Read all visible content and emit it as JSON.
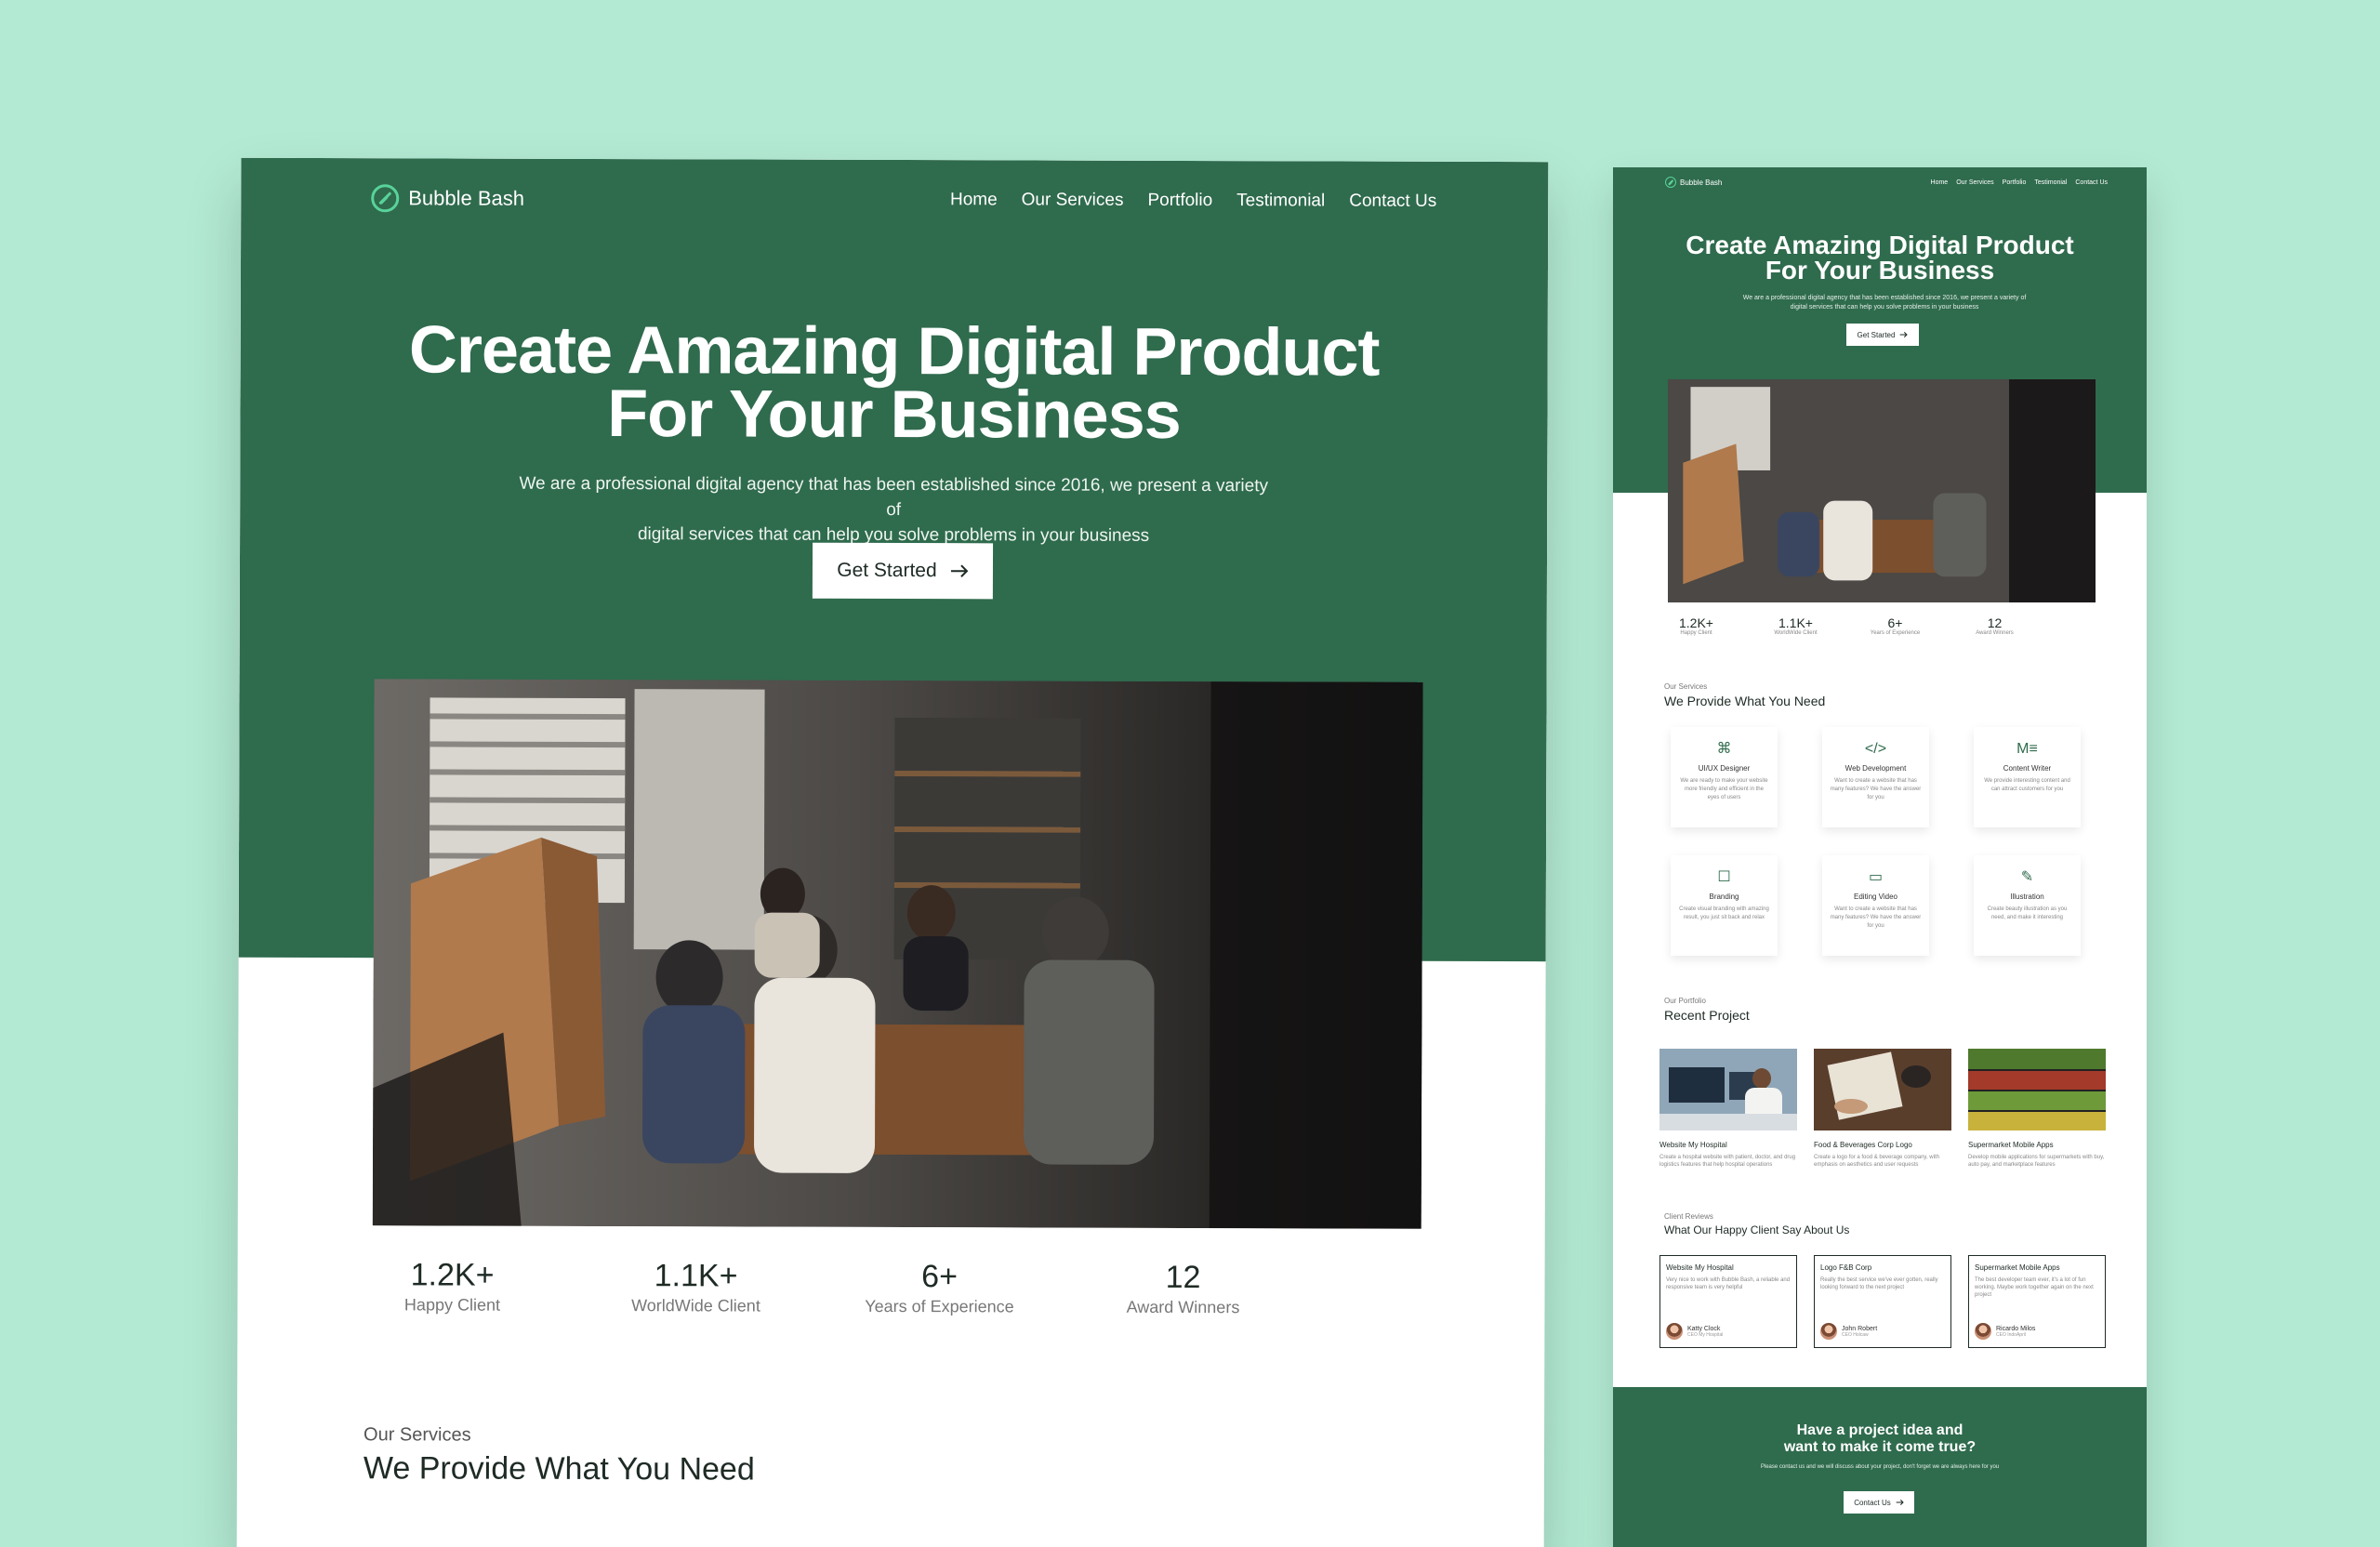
{
  "desktop": {
    "brand": "Bubble Bash",
    "nav": [
      "Home",
      "Our Services",
      "Portfolio",
      "Testimonial",
      "Contact Us"
    ],
    "hero": {
      "title_line1": "Create Amazing Digital Product",
      "title_line2": "For Your Business",
      "subtitle_line1": "We are a professional digital agency that has been established since 2016, we present a variety of",
      "subtitle_line2": "digital services that can help you solve problems in your business",
      "cta": "Get Started",
      "cta_icon": "arrow-right-icon"
    },
    "stats": [
      {
        "value": "1.2K+",
        "label": "Happy Client"
      },
      {
        "value": "1.1K+",
        "label": "WorldWide Client"
      },
      {
        "value": "6+",
        "label": "Years of Experience"
      },
      {
        "value": "12",
        "label": "Award Winners"
      }
    ],
    "services_eyebrow": "Our Services",
    "services_title": "We Provide What You Need"
  },
  "mobile": {
    "brand": "Bubble Bash",
    "nav": [
      "Home",
      "Our Services",
      "Portfolio",
      "Testimonial",
      "Contact Us"
    ],
    "hero": {
      "title_line1": "Create Amazing Digital Product",
      "title_line2": "For Your Business",
      "subtitle_line1": "We are a professional digital agency that has been established since 2016, we present a variety of",
      "subtitle_line2": "digital services that can help you solve problems in your business",
      "cta": "Get Started"
    },
    "stats": [
      {
        "value": "1.2K+",
        "label": "Happy Client"
      },
      {
        "value": "1.1K+",
        "label": "WorldWide Client"
      },
      {
        "value": "6+",
        "label": "Years of Experience"
      },
      {
        "value": "12",
        "label": "Award Winners"
      }
    ],
    "services_eyebrow": "Our Services",
    "services_title": "We Provide What You Need",
    "services": [
      {
        "icon": "figma-icon",
        "name": "UI/UX Designer",
        "desc": "We are ready to make your website more friendly and efficient in the eyes of users"
      },
      {
        "icon": "code-icon",
        "name": "Web Development",
        "desc": "Want to create a website that has many features? We have the answer for you"
      },
      {
        "icon": "text-icon",
        "name": "Content Writer",
        "desc": "We provide interesting content and can attract customers for you"
      },
      {
        "icon": "chat-icon",
        "name": "Branding",
        "desc": "Create visual branding with amazing result, you just sit back and relax"
      },
      {
        "icon": "video-icon",
        "name": "Editing Video",
        "desc": "Want to create a website that has many features? We have the answer for you"
      },
      {
        "icon": "pen-icon",
        "name": "Illustration",
        "desc": "Create beauty illustration as you need, and make it interesting"
      }
    ],
    "portfolio_eyebrow": "Our Portfolio",
    "portfolio_title": "Recent Project",
    "projects": [
      {
        "title": "Website My Hospital",
        "desc": "Create a hospital website with patient, doctor, and drug logistics features that help hospital operations"
      },
      {
        "title": "Food & Beverages Corp Logo",
        "desc": "Create a logo for a food & beverage company, with emphasis on aesthetics and user requests"
      },
      {
        "title": "Supermarket Mobile Apps",
        "desc": "Develop mobile applications for supermarkets with buy, auto pay, and marketplace features"
      }
    ],
    "reviews_eyebrow": "Client Reviews",
    "reviews_title": "What Our Happy Client Say About Us",
    "reviews": [
      {
        "title": "Website My Hospital",
        "text": "Very nice to work with Bubble Bash, a reliable and responsive team is very helpful",
        "name": "Katty Clock",
        "role": "CEO My Hospital"
      },
      {
        "title": "Logo F&B Corp",
        "text": "Really the best service we've ever gotten, really looking forward to the next project",
        "name": "John Robert",
        "role": "CEO Holcaw"
      },
      {
        "title": "Supermarket Mobile Apps",
        "text": "The best developer team ever, it's a lot of fun working. Maybe work together again on the next project",
        "name": "Ricardo Milos",
        "role": "CEO IndoApril"
      }
    ],
    "cta_section": {
      "title_line1": "Have a project idea and",
      "title_line2": "want to make it come true?",
      "subtitle": "Please contact us and we will discuss about your project, don't forget we are always here for you",
      "button": "Contact Us"
    }
  },
  "colors": {
    "background": "#b3ead3",
    "primary_green": "#2f6b4d",
    "logo_accent": "#58d39a"
  }
}
